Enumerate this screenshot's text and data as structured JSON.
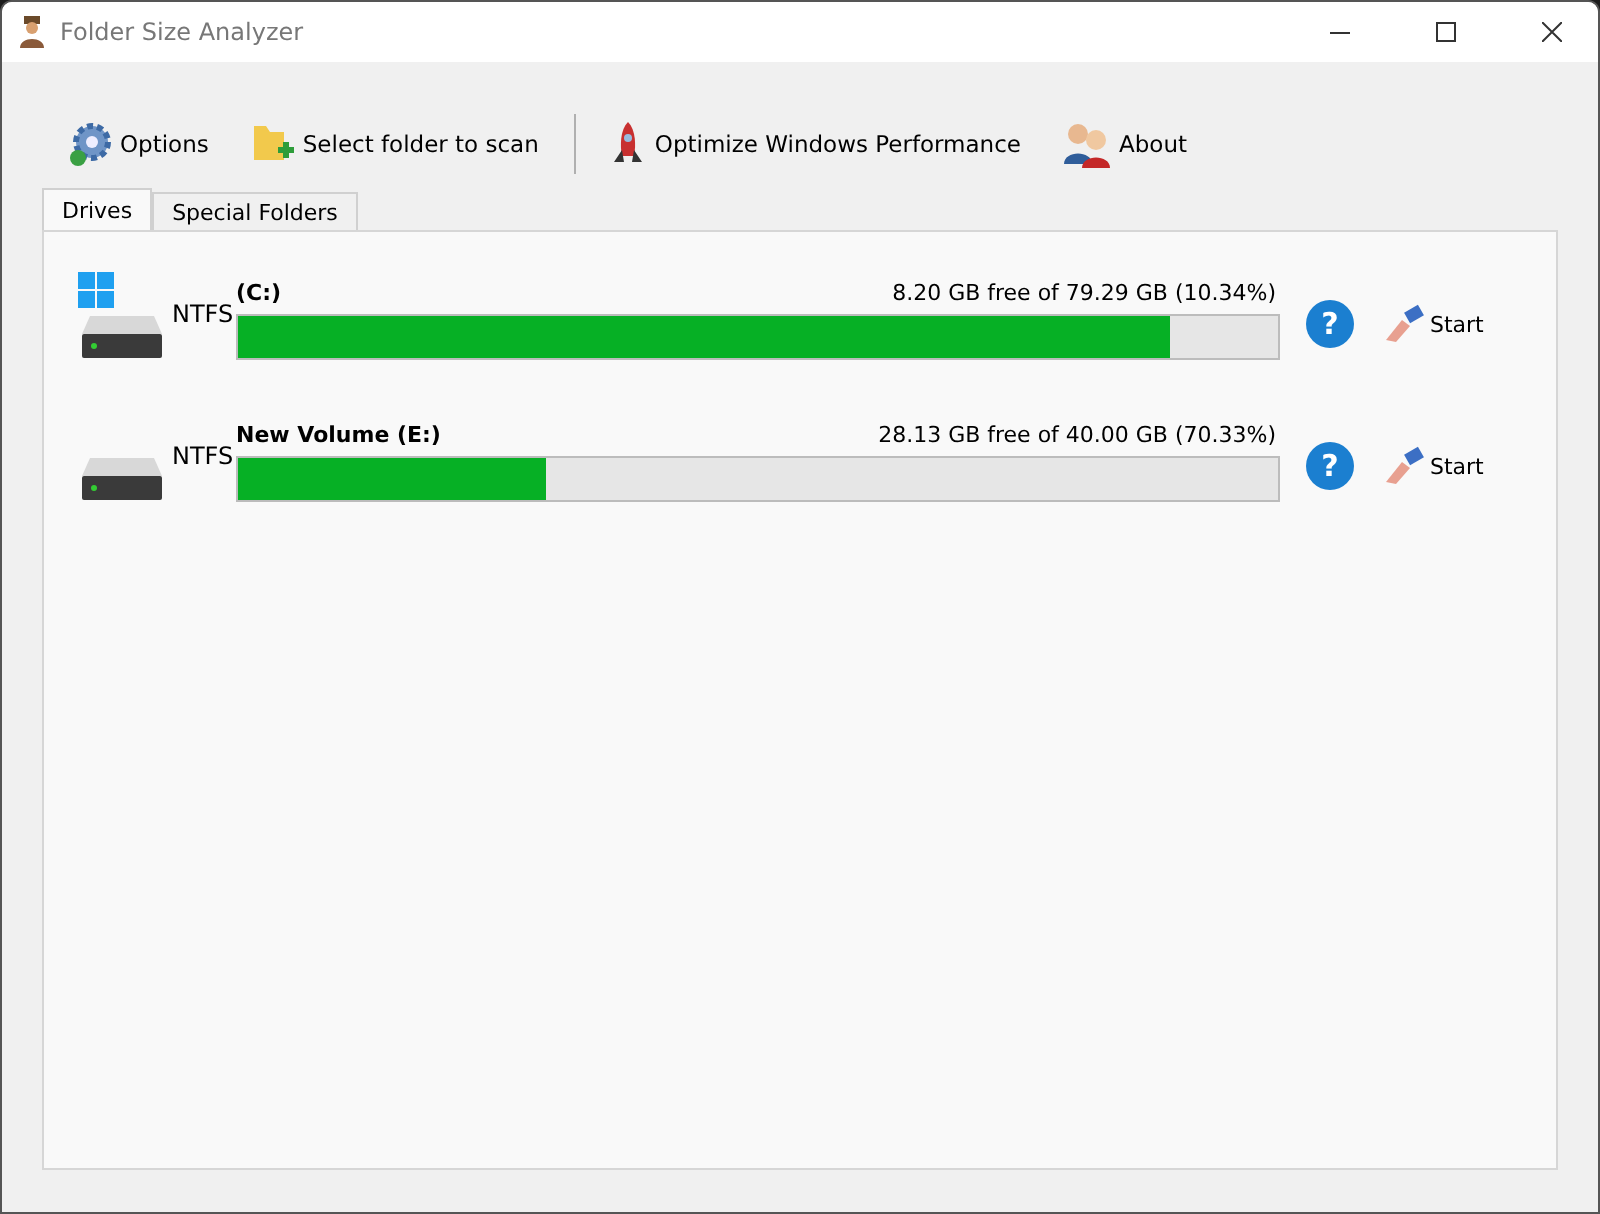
{
  "window": {
    "title": "Folder Size Analyzer"
  },
  "toolbar": [
    {
      "label": "Options",
      "kind": "gear"
    },
    {
      "label": "Select folder to scan",
      "kind": "folder"
    },
    {
      "label": "Optimize Windows Performance",
      "kind": "rocket"
    },
    {
      "label": "About",
      "kind": "people"
    }
  ],
  "tabs": [
    {
      "label": "Drives",
      "selected": true
    },
    {
      "label": "Special Folders",
      "selected": false
    }
  ],
  "drives": [
    {
      "name": "(C:)",
      "filesystem": "NTFS",
      "system": true,
      "free_text": "8.20 GB free of 79.29 GB (10.34%)",
      "level": 0.8966,
      "help": "?",
      "action": "Start"
    },
    {
      "name": "New Volume (E:)",
      "filesystem": "NTFS",
      "system": false,
      "free_text": "28.13 GB free of 40.00 GB (70.33%)",
      "level": 0.2967,
      "help": "?",
      "action": "Start"
    }
  ]
}
